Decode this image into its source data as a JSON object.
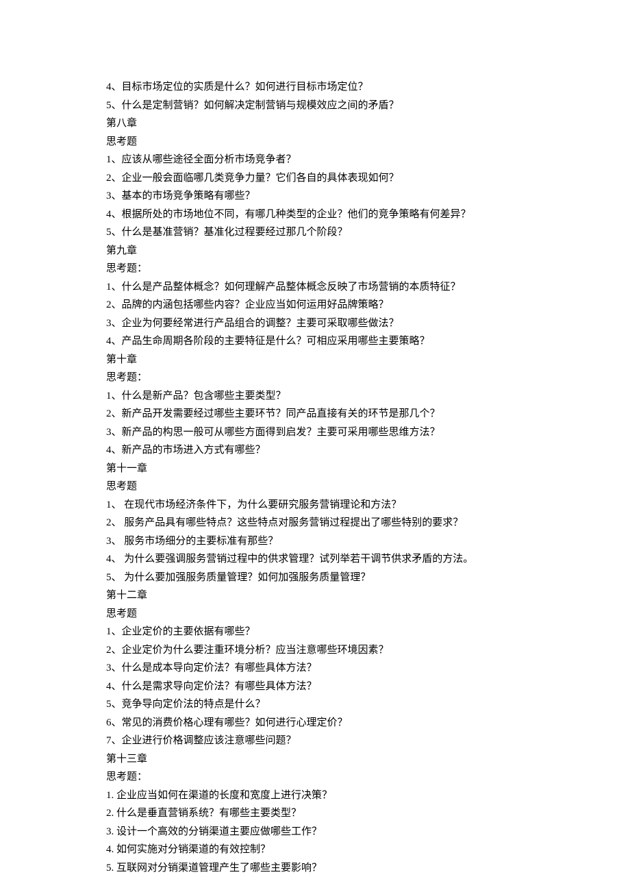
{
  "lines": [
    "4、目标市场定位的实质是什么？如何进行目标市场定位？",
    "5、什么是定制营销？如何解决定制营销与规模效应之间的矛盾？",
    "第八章",
    "思考题",
    "1、应该从哪些途径全面分析市场竞争者？",
    "2、企业一般会面临哪几类竞争力量？它们各自的具体表现如何？",
    "3、基本的市场竞争策略有哪些？",
    "4、根据所处的市场地位不同，有哪几种类型的企业？他们的竞争策略有何差异？",
    "5、什么是基准营销？基准化过程要经过那几个阶段？",
    "第九章",
    "思考题：",
    "1、什么是产品整体概念？如何理解产品整体概念反映了市场营销的本质特征？",
    "2、品牌的内涵包括哪些内容？企业应当如何运用好品牌策略？",
    "3、企业为何要经常进行产品组合的调整？主要可采取哪些做法？",
    "4、产品生命周期各阶段的主要特征是什么？可相应采用哪些主要策略？",
    "第十章",
    "思考题：",
    "1、什么是新产品？包含哪些主要类型？",
    "2、新产品开发需要经过哪些主要环节？同产品直接有关的环节是那几个？",
    "3、新产品的构思一般可从哪些方面得到启发？主要可采用哪些思维方法？",
    "4、新产品的市场进入方式有哪些？",
    "第十一章",
    "思考题",
    "1、 在现代市场经济条件下，为什么要研究服务营销理论和方法？",
    "2、 服务产品具有哪些特点？这些特点对服务营销过程提出了哪些特别的要求？",
    "3、 服务市场细分的主要标准有那些？",
    "4、 为什么要强调服务营销过程中的供求管理？试列举若干调节供求矛盾的方法。",
    "5、 为什么要加强服务质量管理？如何加强服务质量管理？",
    "第十二章",
    "思考题",
    "1、企业定价的主要依据有哪些？",
    "2、企业定价为什么要注重环境分析？应当注意哪些环境因素？",
    "3、什么是成本导向定价法？有哪些具体方法？",
    "4、什么是需求导向定价法？有哪些具体方法？",
    "5、竞争导向定价法的特点是什么？",
    "6、常见的消费价格心理有哪些？如何进行心理定价？",
    "7、企业进行价格调整应该注意哪些问题？",
    "第十三章",
    "思考题：",
    "1.  企业应当如何在渠道的长度和宽度上进行决策？",
    "2.  什么是垂直营销系统？有哪些主要类型？",
    "3.  设计一个高效的分销渠道主要应做哪些工作？",
    "4.  如何实施对分销渠道的有效控制？",
    "5.  互联网对分销渠道管理产生了哪些主要影响？"
  ]
}
